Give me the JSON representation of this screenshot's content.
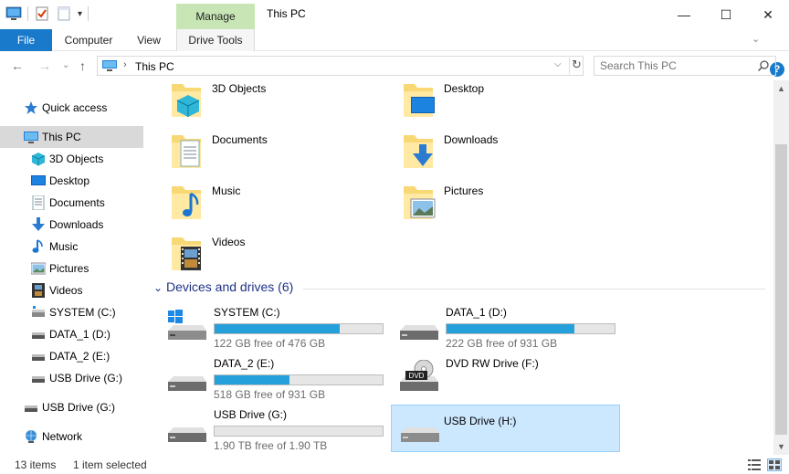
{
  "window": {
    "title": "This PC",
    "manage_tab": "Manage",
    "minimize_glyph": "—",
    "maximize_glyph": "☐",
    "close_glyph": "✕"
  },
  "ribbon": {
    "file": "File",
    "computer": "Computer",
    "view": "View",
    "drive_tools": "Drive Tools",
    "help": "?"
  },
  "address": {
    "path": "This PC",
    "search_placeholder": "Search This PC"
  },
  "nav": {
    "quick_access": "Quick access",
    "this_pc": "This PC",
    "items": [
      {
        "label": "3D Objects",
        "icon": "cube-icon"
      },
      {
        "label": "Desktop",
        "icon": "desktop-icon"
      },
      {
        "label": "Documents",
        "icon": "documents-icon"
      },
      {
        "label": "Downloads",
        "icon": "download-arrow-icon"
      },
      {
        "label": "Music",
        "icon": "music-note-icon"
      },
      {
        "label": "Pictures",
        "icon": "pictures-icon"
      },
      {
        "label": "Videos",
        "icon": "film-icon"
      },
      {
        "label": "SYSTEM (C:)",
        "icon": "drive-icon"
      },
      {
        "label": "DATA_1 (D:)",
        "icon": "drive-icon"
      },
      {
        "label": "DATA_2 (E:)",
        "icon": "drive-icon"
      },
      {
        "label": "USB Drive (G:)",
        "icon": "usb-drive-icon"
      }
    ],
    "usb_root": "USB Drive (G:)",
    "network": "Network"
  },
  "folders": [
    {
      "label": "3D Objects",
      "icon": "cube-folder-icon"
    },
    {
      "label": "Desktop",
      "icon": "desktop-folder-icon"
    },
    {
      "label": "Documents",
      "icon": "documents-folder-icon"
    },
    {
      "label": "Downloads",
      "icon": "downloads-folder-icon"
    },
    {
      "label": "Music",
      "icon": "music-folder-icon"
    },
    {
      "label": "Pictures",
      "icon": "pictures-folder-icon"
    },
    {
      "label": "Videos",
      "icon": "videos-folder-icon"
    }
  ],
  "devices": {
    "header": "Devices and drives (6)",
    "drives": [
      {
        "label": "SYSTEM (C:)",
        "free": "122 GB free of 476 GB",
        "used_fraction": 0.744,
        "icon": "windows-drive-icon"
      },
      {
        "label": "DATA_1 (D:)",
        "free": "222 GB free of 931 GB",
        "used_fraction": 0.762,
        "icon": "drive-icon"
      },
      {
        "label": "DATA_2 (E:)",
        "free": "518 GB free of 931 GB",
        "used_fraction": 0.444,
        "icon": "drive-icon"
      },
      {
        "label": "DVD RW Drive (F:)",
        "free": "",
        "icon": "dvd-drive-icon",
        "dvd_text": "DVD"
      },
      {
        "label": "USB Drive (G:)",
        "free": "1.90 TB free of 1.90 TB",
        "used_fraction": 0.0,
        "icon": "drive-icon"
      },
      {
        "label": "USB Drive (H:)",
        "free": "",
        "icon": "drive-icon",
        "selected": true
      }
    ]
  },
  "status": {
    "items": "13 items",
    "selected": "1 item selected"
  },
  "colors": {
    "accent": "#1979ca",
    "bar_fill": "#26a0da",
    "manage_bg": "#c8e6b5",
    "selected_bg": "#cce8ff",
    "group_header": "#1e3287"
  }
}
